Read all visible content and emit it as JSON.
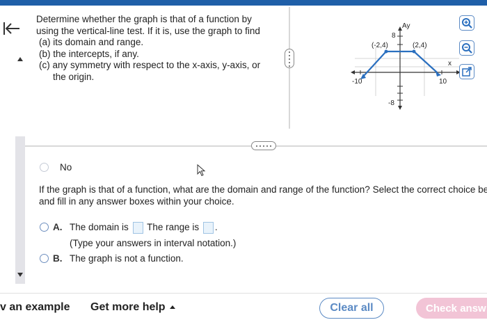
{
  "question": {
    "intro": "Determine whether the graph is that of a function by using the vertical-line test. If it is, use the graph to find",
    "item_a": "(a) its domain and range.",
    "item_b": "(b) the intercepts, if any.",
    "item_c_line1": "(c) any symmetry with respect to the x-axis, y-axis, or",
    "item_c_line2": "the origin."
  },
  "graph": {
    "y_axis_label": "Ay",
    "x_axis_label": "x",
    "y_top_tick": "8",
    "y_bottom_tick": "-8",
    "x_left_tick": "-10",
    "x_right_tick": "10",
    "point_left": "(-2,4)",
    "point_right": "(2,4)"
  },
  "previous_answer": {
    "label": "No"
  },
  "prompt": {
    "line1": "If the graph is that of a function, what are the domain and range of the function? Select the correct choice below",
    "line2": "and fill in any answer boxes within your choice."
  },
  "choices": {
    "a_letter": "A.",
    "a_domain": "The domain is",
    "a_range": "The range is",
    "a_period": ".",
    "a_hint": "(Type your answers in interval notation.)",
    "b_letter": "B.",
    "b_text": "The graph is not a function."
  },
  "footer": {
    "example": "v an example",
    "help": "Get more help",
    "clear": "Clear all",
    "check": "Check answ"
  },
  "colors": {
    "accent": "#5b8ac4",
    "topbar": "#1f5fa8",
    "graph_line": "#2a6fbf",
    "check_button": "#f2c4d6"
  }
}
